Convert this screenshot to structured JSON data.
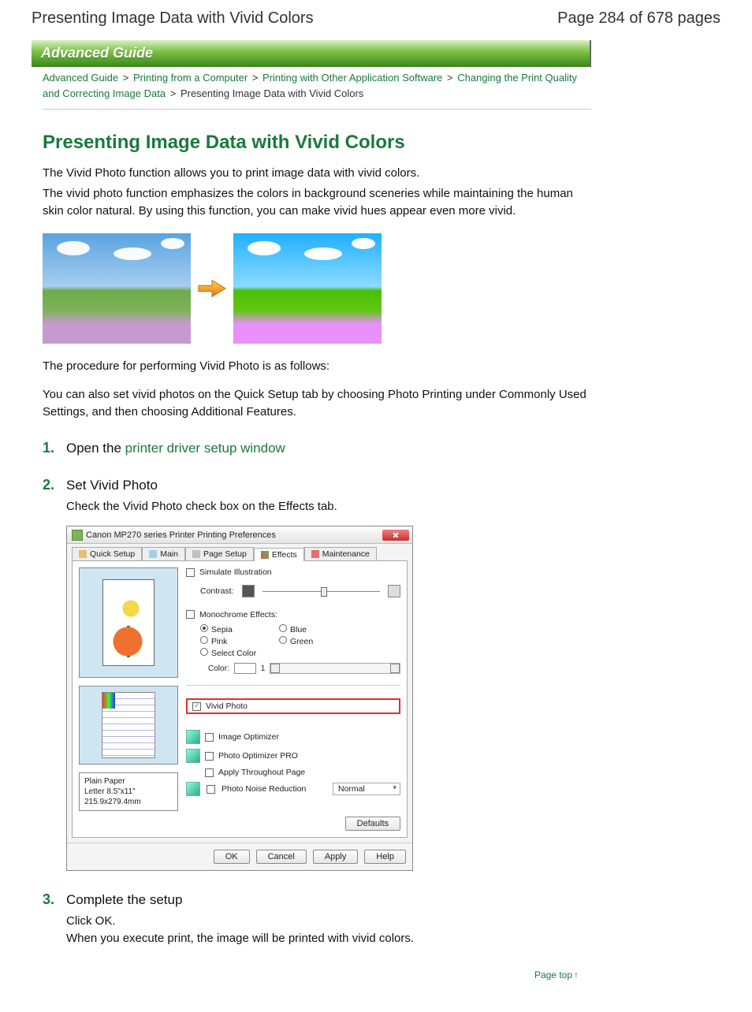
{
  "page_header": {
    "title": "Presenting Image Data with Vivid Colors",
    "page_label": "Page 284 of 678 pages"
  },
  "banner": {
    "label": "Advanced Guide"
  },
  "breadcrumb": {
    "items": [
      "Advanced Guide",
      "Printing from a Computer",
      "Printing with Other Application Software",
      "Changing the Print Quality and Correcting Image Data"
    ],
    "current": "Presenting Image Data with Vivid Colors",
    "sep": ">"
  },
  "h1": "Presenting Image Data with Vivid Colors",
  "intro": {
    "p1": "The Vivid Photo function allows you to print image data with vivid colors.",
    "p2": "The vivid photo function emphasizes the colors in background sceneries while maintaining the human skin color natural. By using this function, you can make vivid hues appear even more vivid."
  },
  "mid": {
    "p1": "The procedure for performing Vivid Photo is as follows:",
    "p2": "You can also set vivid photos on the Quick Setup tab by choosing Photo Printing under Commonly Used Settings, and then choosing Additional Features."
  },
  "steps": [
    {
      "num": "1.",
      "title_pre": "Open the ",
      "title_link": "printer driver setup window",
      "body": ""
    },
    {
      "num": "2.",
      "title_pre": "Set Vivid Photo",
      "title_link": "",
      "body": "Check the Vivid Photo check box on the Effects tab."
    },
    {
      "num": "3.",
      "title_pre": "Complete the setup",
      "title_link": "",
      "body": "Click OK.\nWhen you execute print, the image will be printed with vivid colors."
    }
  ],
  "dialog": {
    "title": "Canon MP270 series Printer Printing Preferences",
    "tabs": [
      "Quick Setup",
      "Main",
      "Page Setup",
      "Effects",
      "Maintenance"
    ],
    "simulate": "Simulate Illustration",
    "contrast": "Contrast:",
    "mono": "Monochrome Effects:",
    "radios": {
      "sepia": "Sepia",
      "blue": "Blue",
      "pink": "Pink",
      "green": "Green",
      "select": "Select Color"
    },
    "color_label": "Color:",
    "color_value": "1",
    "vivid": "Vivid Photo",
    "image_opt": "Image Optimizer",
    "photo_opt": "Photo Optimizer PRO",
    "apply_throughout": "Apply Throughout Page",
    "noise": "Photo Noise Reduction",
    "noise_value": "Normal",
    "paper1": "Plain Paper",
    "paper2": "Letter 8.5\"x11\" 215.9x279.4mm",
    "defaults": "Defaults",
    "buttons": {
      "ok": "OK",
      "cancel": "Cancel",
      "apply": "Apply",
      "help": "Help"
    }
  },
  "page_top": "Page top"
}
